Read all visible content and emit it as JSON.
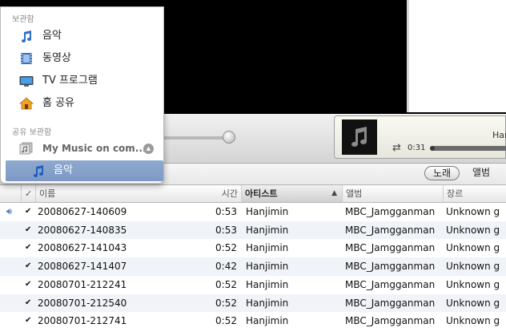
{
  "menu": {
    "library_header": "보관함",
    "library_items": [
      {
        "label": "음악",
        "icon": "music-note-icon"
      },
      {
        "label": "동영상",
        "icon": "film-icon"
      },
      {
        "label": "TV 프로그램",
        "icon": "tv-icon"
      },
      {
        "label": "홈 공유",
        "icon": "home-icon"
      }
    ],
    "shared_header": "공유 보관함",
    "shared_library": {
      "label": "My Music on com...",
      "icon": "shared-library-icon",
      "eject_icon": "eject-icon"
    },
    "shared_music": {
      "label": "음악",
      "icon": "music-note-icon"
    }
  },
  "now_playing": {
    "title": "Har",
    "elapsed": "0:31",
    "progress": 0.06,
    "artwork_icon": "music-note-icon",
    "repeat_icon": "repeat-icon"
  },
  "view_buttons": {
    "songs": "노래",
    "albums": "앨범"
  },
  "table": {
    "columns": {
      "check": "✓",
      "name": "이름",
      "time": "시간",
      "artist": "아티스트",
      "album": "앨범",
      "genre": "장르"
    },
    "sort_column": "artist",
    "sort_arrow": "▲",
    "rows": [
      {
        "name": "20080627-140609",
        "time": "0:53",
        "artist": "Hanjimin",
        "album": "MBC_Jamgganman",
        "genre": "Unknown g",
        "playing": true
      },
      {
        "name": "20080627-140835",
        "time": "0:53",
        "artist": "Hanjimin",
        "album": "MBC_Jamgganman",
        "genre": "Unknown g",
        "playing": false
      },
      {
        "name": "20080627-141043",
        "time": "0:52",
        "artist": "Hanjimin",
        "album": "MBC_Jamgganman",
        "genre": "Unknown g",
        "playing": false
      },
      {
        "name": "20080627-141407",
        "time": "0:42",
        "artist": "Hanjimin",
        "album": "MBC_Jamgganman",
        "genre": "Unknown g",
        "playing": false
      },
      {
        "name": "20080701-212241",
        "time": "0:52",
        "artist": "Hanjimin",
        "album": "MBC_Jamgganman",
        "genre": "Unknown g",
        "playing": false
      },
      {
        "name": "20080701-212540",
        "time": "0:52",
        "artist": "Hanjimin",
        "album": "MBC_Jamgganman",
        "genre": "Unknown g",
        "playing": false
      },
      {
        "name": "20080701-212741",
        "time": "0:52",
        "artist": "Hanjimin",
        "album": "MBC_Jamgganman",
        "genre": "Unknown g",
        "playing": false
      }
    ]
  }
}
